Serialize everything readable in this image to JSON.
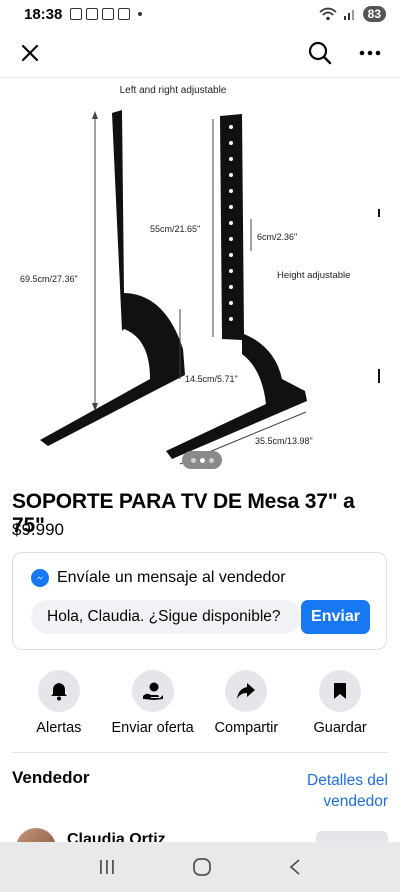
{
  "status_bar": {
    "time": "18:38",
    "battery": "83"
  },
  "product": {
    "title": "SOPORTE PARA TV DE Mesa 37\" a 75\"",
    "price": "$9.990",
    "image_labels": {
      "top": "Left and right adjustable",
      "height_left": "69.5cm/27.36\"",
      "height_mid": "55cm/21.65\"",
      "hole_spacing": "6cm/2.36\"",
      "height_adj": "Height adjustable",
      "base_depth": "14.5cm/5.71\"",
      "base_length": "35.5cm/13.98\""
    },
    "carousel": {
      "count": 3,
      "active": 1
    }
  },
  "message_card": {
    "header": "Envíale un mensaje al vendedor",
    "input_value": "Hola, Claudia. ¿Sigue disponible?",
    "send_label": "Enviar"
  },
  "actions": [
    {
      "label": "Alertas",
      "icon": "bell-icon"
    },
    {
      "label": "Enviar oferta",
      "icon": "offer-icon"
    },
    {
      "label": "Compartir",
      "icon": "share-icon"
    },
    {
      "label": "Guardar",
      "icon": "bookmark-icon"
    }
  ],
  "seller": {
    "title": "Vendedor",
    "details_link": "Detalles del vendedor",
    "name": "Claudia Ortiz"
  },
  "colors": {
    "accent": "#1877f2",
    "link": "#216fdb",
    "chip_bg": "#e4e6eb"
  }
}
